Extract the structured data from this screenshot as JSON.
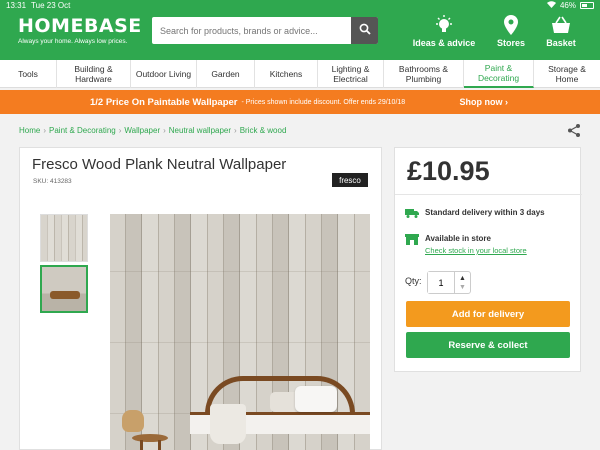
{
  "status": {
    "time": "13:31",
    "date": "Tue 23 Oct",
    "battery": "46%"
  },
  "header": {
    "logo": "HOMEBASE",
    "tagline": "Always your home. Always low prices.",
    "search_placeholder": "Search for products, brands or advice...",
    "items": [
      {
        "label": "Ideas & advice",
        "icon": "lightbulb-icon"
      },
      {
        "label": "Stores",
        "icon": "location-pin-icon"
      },
      {
        "label": "Basket",
        "icon": "basket-icon"
      }
    ]
  },
  "nav": [
    {
      "label": "Tools"
    },
    {
      "label": "Building & Hardware"
    },
    {
      "label": "Outdoor Living"
    },
    {
      "label": "Garden"
    },
    {
      "label": "Kitchens"
    },
    {
      "label": "Lighting & Electrical"
    },
    {
      "label": "Bathrooms & Plumbing"
    },
    {
      "label": "Paint & Decorating",
      "active": true
    },
    {
      "label": "Storage & Home"
    }
  ],
  "promo": {
    "main": "1/2 Price On Paintable Wallpaper",
    "sub": "- Prices shown include discount. Offer ends 29/10/18",
    "cta": "Shop now ›"
  },
  "breadcrumb": [
    "Home",
    "Paint & Decorating",
    "Wallpaper",
    "Neutral wallpaper",
    "Brick & wood"
  ],
  "product": {
    "title": "Fresco Wood Plank Neutral Wallpaper",
    "sku": "SKU: 413283",
    "brand": "fresco",
    "price": "£10.95",
    "delivery": "Standard delivery within 3 days",
    "store": "Available in store",
    "store_link": "Check stock in your local store",
    "qty_label": "Qty:",
    "qty_value": "1",
    "add_delivery": "Add for delivery",
    "reserve": "Reserve & collect"
  },
  "colors": {
    "brand_green": "#2fa84f",
    "promo_orange": "#f47c20",
    "cta_orange": "#f39a1e"
  }
}
